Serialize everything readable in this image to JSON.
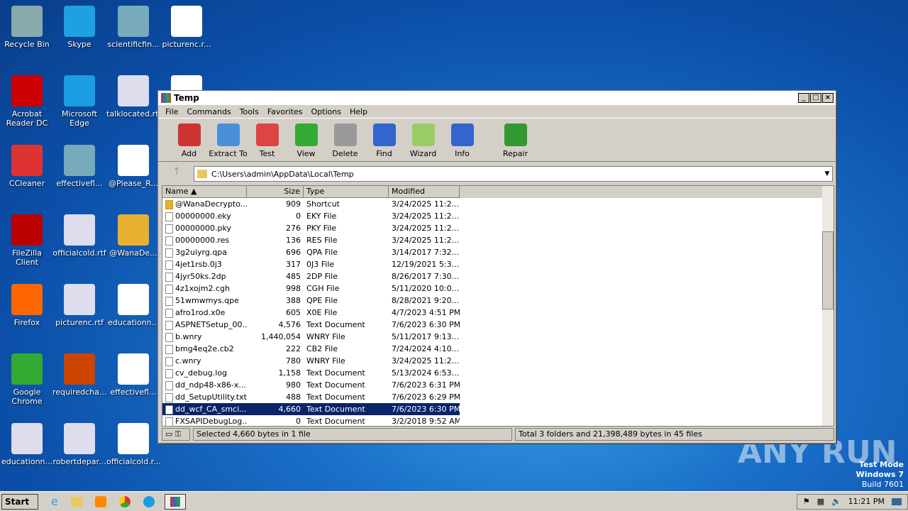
{
  "desktop_icons": [
    {
      "label": "Recycle Bin",
      "color": "#8aa"
    },
    {
      "label": "Skype",
      "color": "#1fa0e0"
    },
    {
      "label": "scientificfin...",
      "color": "#7ab"
    },
    {
      "label": "picturenc.r...",
      "color": "#fff"
    },
    {
      "label": "Acrobat Reader DC",
      "color": "#c00"
    },
    {
      "label": "Microsoft Edge",
      "color": "#1b9de2"
    },
    {
      "label": "talklocated.rtf",
      "color": "#dde"
    },
    {
      "label": "",
      "color": "#fff"
    },
    {
      "label": "CCleaner",
      "color": "#d33"
    },
    {
      "label": "effectivefl...",
      "color": "#7ab"
    },
    {
      "label": "@Please_R...",
      "color": "#fff"
    },
    {
      "label": "FileZilla Client",
      "color": "#b00"
    },
    {
      "label": "officialcold.rtf",
      "color": "#dde"
    },
    {
      "label": "@WanaDe...",
      "color": "#e8b030"
    },
    {
      "label": "Firefox",
      "color": "#f60"
    },
    {
      "label": "picturenc.rtf",
      "color": "#dde"
    },
    {
      "label": "educationn...",
      "color": "#fff"
    },
    {
      "label": "Google Chrome",
      "color": "#3a3"
    },
    {
      "label": "requiredcha...",
      "color": "#c40"
    },
    {
      "label": "effectivefl...",
      "color": "#fff"
    },
    {
      "label": "educationn...",
      "color": "#dde"
    },
    {
      "label": "robertdepar...",
      "color": "#dde"
    },
    {
      "label": "officialcold.r...",
      "color": "#fff"
    }
  ],
  "window": {
    "title": "Temp",
    "menu": [
      "File",
      "Commands",
      "Tools",
      "Favorites",
      "Options",
      "Help"
    ],
    "toolbar": [
      {
        "label": "Add",
        "color": "#c33"
      },
      {
        "label": "Extract To",
        "color": "#4a90d9"
      },
      {
        "label": "Test",
        "color": "#d44"
      },
      {
        "label": "View",
        "color": "#3a3"
      },
      {
        "label": "Delete",
        "color": "#999"
      },
      {
        "label": "Find",
        "color": "#36c"
      },
      {
        "label": "Wizard",
        "color": "#9c6"
      },
      {
        "label": "Info",
        "color": "#36c"
      },
      {
        "label": "Repair",
        "color": "#393"
      }
    ],
    "address": "C:\\Users\\admin\\AppData\\Local\\Temp",
    "columns": [
      "Name",
      "Size",
      "Type",
      "Modified"
    ],
    "files": [
      [
        "@WanaDecrypto...",
        "909",
        "Shortcut",
        "3/24/2025 11:2..."
      ],
      [
        "00000000.eky",
        "0",
        "EKY File",
        "3/24/2025 11:2..."
      ],
      [
        "00000000.pky",
        "276",
        "PKY File",
        "3/24/2025 11:2..."
      ],
      [
        "00000000.res",
        "136",
        "RES File",
        "3/24/2025 11:2..."
      ],
      [
        "3g2uiyrg.qpa",
        "696",
        "QPA File",
        "3/14/2017 7:32..."
      ],
      [
        "4jet1rsb.0j3",
        "317",
        "0J3 File",
        "12/19/2021 5:3..."
      ],
      [
        "4jyr50ks.2dp",
        "485",
        "2DP File",
        "8/26/2017 7:30..."
      ],
      [
        "4z1xojm2.cgh",
        "998",
        "CGH File",
        "5/11/2020 10:0..."
      ],
      [
        "51wmwmys.qpe",
        "388",
        "QPE File",
        "8/28/2021 9:20..."
      ],
      [
        "afro1rod.x0e",
        "605",
        "X0E File",
        "4/7/2023 4:51 PM"
      ],
      [
        "ASPNETSetup_00...",
        "4,576",
        "Text Document",
        "7/6/2023 6:30 PM"
      ],
      [
        "b.wnry",
        "1,440,054",
        "WNRY File",
        "5/11/2017 9:13..."
      ],
      [
        "bmg4eq2e.cb2",
        "222",
        "CB2 File",
        "7/24/2024 4:10..."
      ],
      [
        "c.wnry",
        "780",
        "WNRY File",
        "3/24/2025 11:2..."
      ],
      [
        "cv_debug.log",
        "1,158",
        "Text Document",
        "5/13/2024 6:53..."
      ],
      [
        "dd_ndp48-x86-x...",
        "980",
        "Text Document",
        "7/6/2023 6:31 PM"
      ],
      [
        "dd_SetupUtility.txt",
        "488",
        "Text Document",
        "7/6/2023 6:29 PM"
      ],
      [
        "dd_wcf_CA_smci...",
        "4,660",
        "Text Document",
        "7/6/2023 6:30 PM"
      ],
      [
        "FXSAPIDebugLog...",
        "0",
        "Text Document",
        "3/2/2018 9:52 AM"
      ]
    ],
    "selected_index": 17,
    "status_left": "Selected 4,660 bytes in 1 file",
    "status_right": "Total 3 folders and 21,398,489 bytes in 45 files"
  },
  "taskbar": {
    "start": "Start",
    "time": "11:21 PM"
  },
  "watermark": [
    "Test Mode",
    "Windows 7",
    "Build 7601"
  ],
  "anyrun": "ANY RUN"
}
